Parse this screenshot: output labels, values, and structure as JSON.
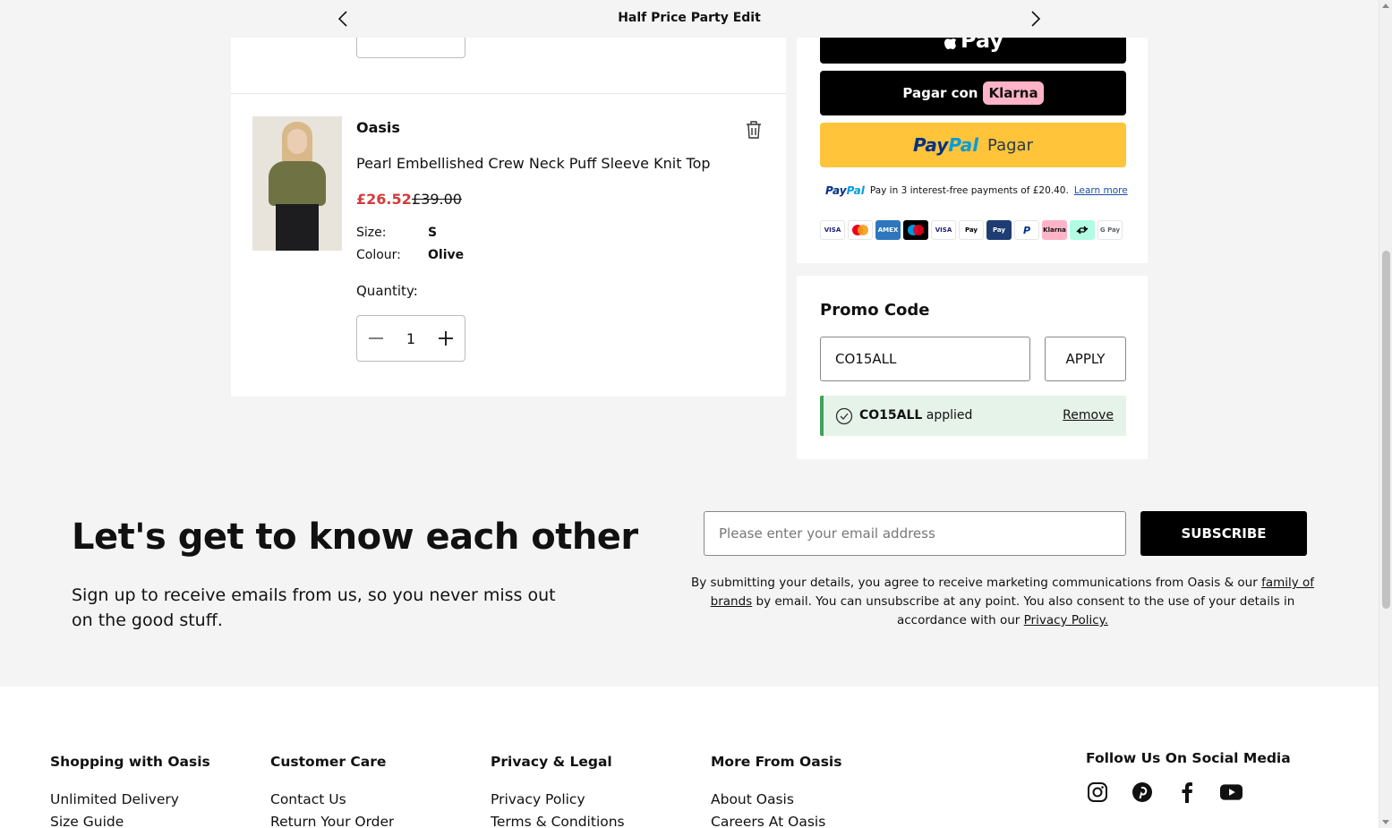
{
  "topbar": {
    "title": "Half Price Party Edit"
  },
  "cart": {
    "item": {
      "brand": "Oasis",
      "name": "Pearl Embellished Crew Neck Puff Sleeve Knit Top",
      "price_sale": "£26.52",
      "price_was": "£39.00",
      "size_label": "Size:",
      "size_value": "S",
      "colour_label": "Colour:",
      "colour_value": "Olive",
      "quantity_label": "Quantity:",
      "quantity_value": "1"
    }
  },
  "payment": {
    "applepay_label": "Pay",
    "klarna_prefix": "Pagar con",
    "klarna_brand": "Klarna",
    "paypal_pay": "Pay",
    "paypal_pal": "Pal",
    "paypal_action": "Pagar",
    "paypal_logo_pay": "Pay",
    "paypal_logo_pal": "Pal",
    "paypal_message": "Pay in 3 interest-free payments of £20.40.",
    "paypal_learn_more": "Learn more",
    "methods": [
      "VISA",
      "MC",
      "AMEX",
      "Maestro",
      "VISA",
      "Pay",
      "Pay",
      "P",
      "Klarna",
      "Afterpay",
      "G Pay"
    ]
  },
  "promo": {
    "title": "Promo Code",
    "input_value": "CO15ALL",
    "apply_label": "APPLY",
    "applied_code": "CO15ALL",
    "applied_text": "applied",
    "remove_label": "Remove"
  },
  "newsletter": {
    "heading": "Let's get to know each other",
    "subtext": "Sign up to receive emails from us, so you never miss out on the good stuff.",
    "email_placeholder": "Please enter your email address",
    "subscribe_label": "SUBSCRIBE",
    "legal_part1": "By submitting your details, you agree to receive marketing communications from Oasis & our",
    "legal_link1": "family of brands",
    "legal_part2": "by email. You can unsubscribe at any point. You also consent to the use of your details in accordance with our",
    "legal_link2": "Privacy Policy."
  },
  "footer": {
    "columns": [
      {
        "title": "Shopping with Oasis",
        "first": "Unlimited Delivery",
        "second": "Size Guide"
      },
      {
        "title": "Customer Care",
        "first": "Contact Us",
        "second": "Return Your Order"
      },
      {
        "title": "Privacy & Legal",
        "first": "Privacy Policy",
        "second": "Terms & Conditions"
      },
      {
        "title": "More From Oasis",
        "first": "About Oasis",
        "second": "Careers At Oasis"
      }
    ],
    "social_title": "Follow Us On Social Media"
  },
  "icons": {
    "topbar_prev": "chevron-left-icon",
    "topbar_next": "chevron-right-icon",
    "delete": "trash-icon",
    "minus": "minus-icon",
    "plus": "plus-icon",
    "applied": "check-circle-icon",
    "social": [
      "instagram-icon",
      "pinterest-icon",
      "facebook-icon",
      "youtube-icon"
    ]
  },
  "colors": {
    "sale_price": "#d43b3b",
    "paypal_button": "#ffc439",
    "klarna_badge": "#ffb3c7",
    "promo_applied_bg": "#e6f3e8",
    "promo_applied_accent": "#3fa35a"
  }
}
